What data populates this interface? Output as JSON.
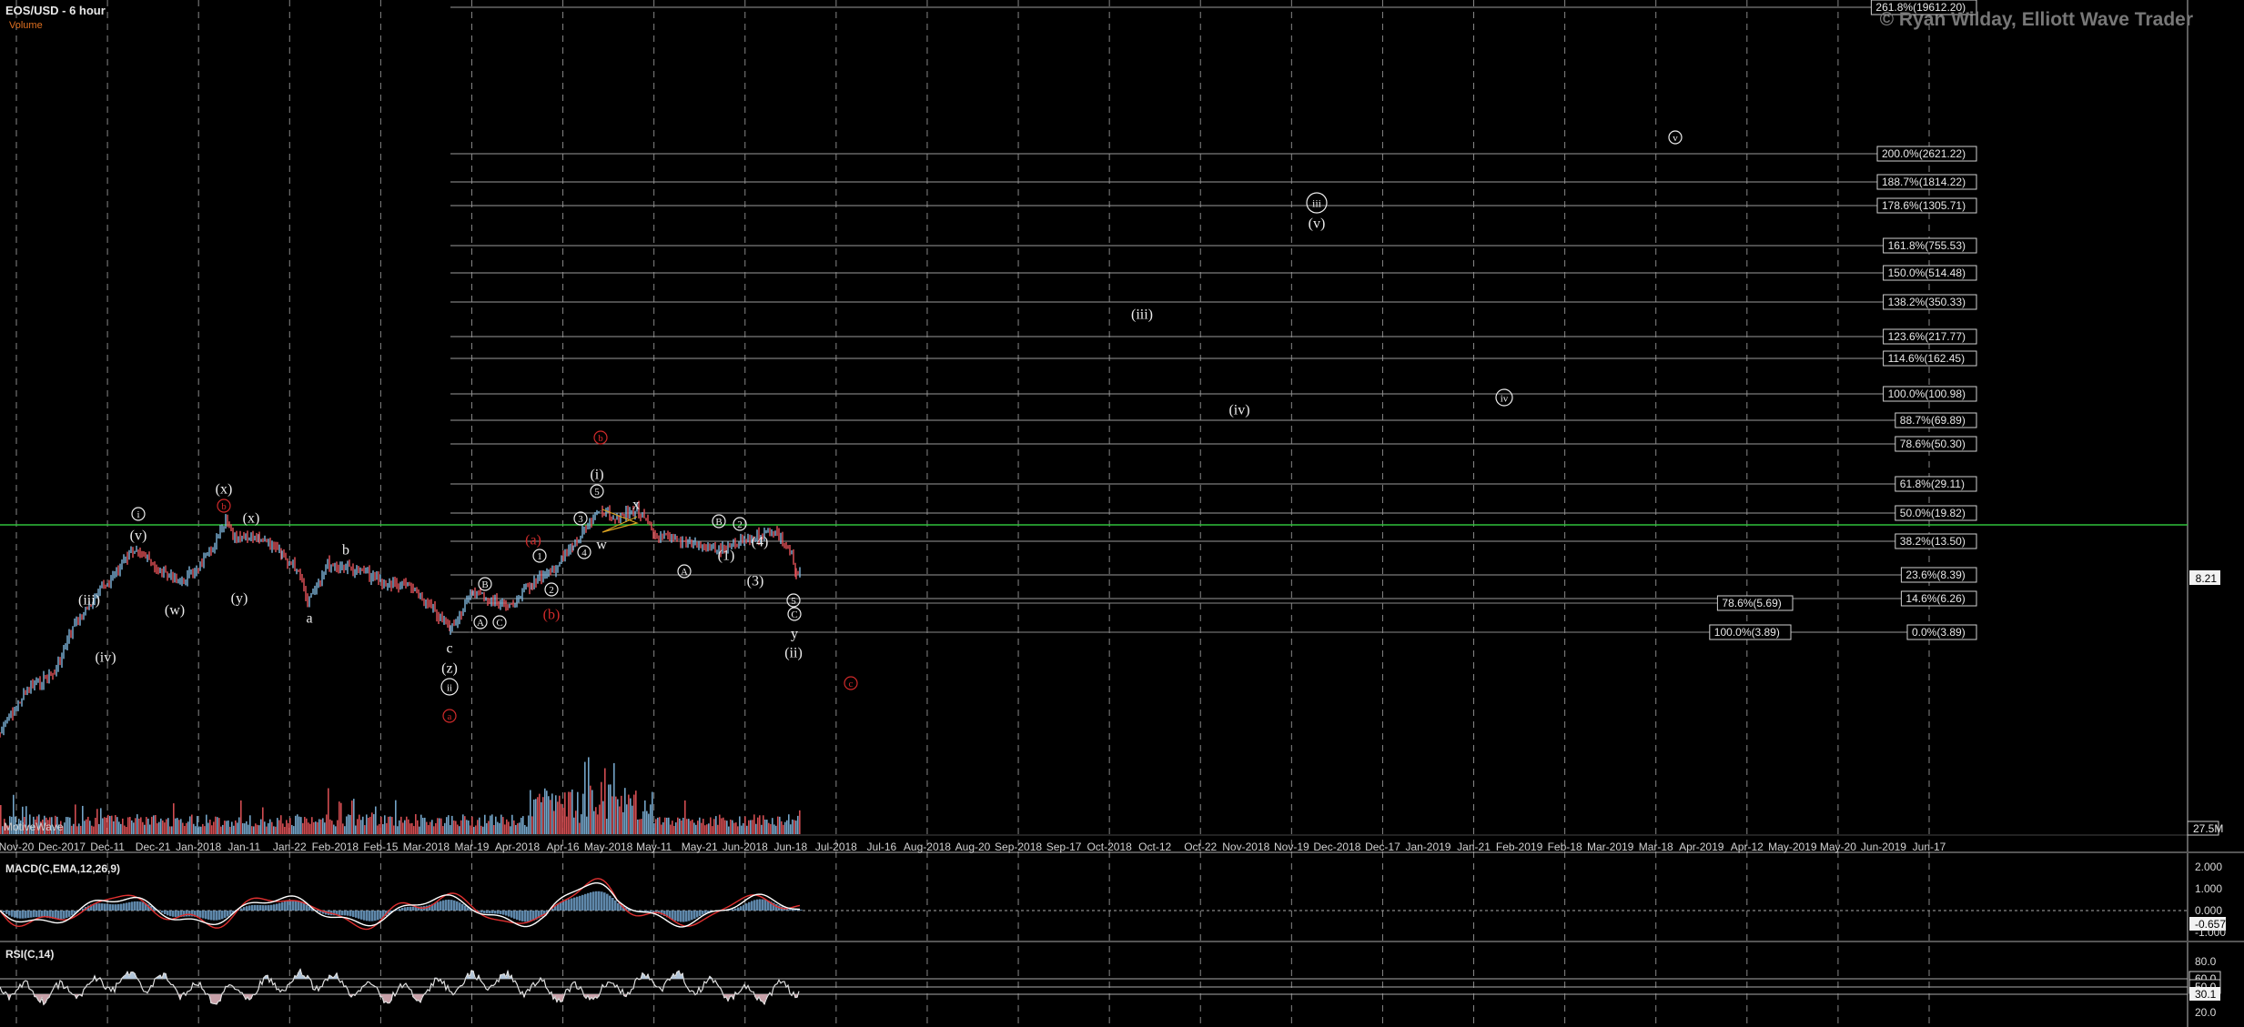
{
  "header": {
    "title": "EOS/USD - 6 hour",
    "volume_label": "Volume",
    "copyright": "© Ryan Wilday, Elliott Wave Trader",
    "watermark": "MotiveWave"
  },
  "indicators": {
    "macd_title": "MACD(C,EMA,12,26,9)",
    "rsi_title": "RSI(C,14)"
  },
  "price_axis": {
    "current_price": "8.21",
    "volume_tag": "27.5M"
  },
  "macd_axis": [
    "2.000",
    "1.000",
    "0.000",
    "-0.657",
    "-1.000"
  ],
  "rsi_axis": [
    "80.0",
    "60.0",
    "50.0",
    "30.1",
    "20.0"
  ],
  "colors": {
    "background": "#000000",
    "up_candle": "#7fb6dd",
    "down_candle": "#e8545a",
    "green_line": "#2fbf3a",
    "macd_line": "#ffffff",
    "signal_line": "#e03030",
    "histogram": "#6f9fc8",
    "red_label": "#d02a2a"
  },
  "chart_data": {
    "type": "line",
    "title": "EOS/USD - 6 hour",
    "x_labels": [
      "Nov-20",
      "Dec-2017",
      "Dec-11",
      "Dec-21",
      "Jan-2018",
      "Jan-11",
      "Jan-22",
      "Feb-2018",
      "Feb-15",
      "Mar-2018",
      "Mar-19",
      "Apr-2018",
      "Apr-16",
      "May-2018",
      "May-11",
      "May-21",
      "Jun-2018",
      "Jun-18",
      "Jul-2018",
      "Jul-16",
      "Aug-2018",
      "Aug-20",
      "Sep-2018",
      "Sep-17",
      "Oct-2018",
      "Oct-12",
      "Oct-22",
      "Nov-2018",
      "Nov-19",
      "Dec-2018",
      "Dec-17",
      "Jan-2019",
      "Jan-21",
      "Feb-2019",
      "Feb-18",
      "Mar-2019",
      "Mar-18",
      "Apr-2019",
      "Apr-12",
      "May-2019",
      "May-20",
      "Jun-2019",
      "Jun-17"
    ],
    "fib_levels": [
      {
        "label": "261.8%(19612.20)"
      },
      {
        "label": "200.0%(2621.22)"
      },
      {
        "label": "188.7%(1814.22)"
      },
      {
        "label": "178.6%(1305.71)"
      },
      {
        "label": "161.8%(755.53)"
      },
      {
        "label": "150.0%(514.48)"
      },
      {
        "label": "138.2%(350.33)"
      },
      {
        "label": "123.6%(217.77)"
      },
      {
        "label": "114.6%(162.45)"
      },
      {
        "label": "100.0%(100.98)"
      },
      {
        "label": "88.7%(69.89)"
      },
      {
        "label": "78.6%(50.30)"
      },
      {
        "label": "61.8%(29.11)"
      },
      {
        "label": "50.0%(19.82)"
      },
      {
        "label": "38.2%(13.50)"
      },
      {
        "label": "23.6%(8.39)"
      },
      {
        "label": "14.6%(6.26)"
      },
      {
        "label": "0.0%(3.89)"
      }
    ],
    "retracement_levels": [
      {
        "label": "78.6%(5.69)"
      },
      {
        "label": "100.0%(3.89)"
      }
    ],
    "wave_labels": [
      {
        "text": "i",
        "circled": true,
        "color": "white"
      },
      {
        "text": "(v)",
        "circled": false,
        "color": "white"
      },
      {
        "text": "(x)",
        "circled": false,
        "color": "white"
      },
      {
        "text": "b",
        "circled": true,
        "color": "red"
      },
      {
        "text": "(x)",
        "circled": false,
        "color": "white"
      },
      {
        "text": "b",
        "circled": false,
        "color": "white"
      },
      {
        "text": "(iii)",
        "circled": false,
        "color": "white"
      },
      {
        "text": "(w)",
        "circled": false,
        "color": "white"
      },
      {
        "text": "(y)",
        "circled": false,
        "color": "white"
      },
      {
        "text": "a",
        "circled": false,
        "color": "white"
      },
      {
        "text": "(iv)",
        "circled": false,
        "color": "white"
      },
      {
        "text": "c",
        "circled": false,
        "color": "white"
      },
      {
        "text": "(z)",
        "circled": false,
        "color": "white"
      },
      {
        "text": "ii",
        "circled": true,
        "color": "white"
      },
      {
        "text": "a",
        "circled": true,
        "color": "red"
      },
      {
        "text": "B",
        "circled": true,
        "color": "white"
      },
      {
        "text": "A",
        "circled": true,
        "color": "white"
      },
      {
        "text": "C",
        "circled": true,
        "color": "white"
      },
      {
        "text": "1",
        "circled": true,
        "color": "white"
      },
      {
        "text": "2",
        "circled": true,
        "color": "white"
      },
      {
        "text": "3",
        "circled": true,
        "color": "white"
      },
      {
        "text": "4",
        "circled": true,
        "color": "white"
      },
      {
        "text": "5",
        "circled": true,
        "color": "white"
      },
      {
        "text": "(i)",
        "circled": false,
        "color": "white"
      },
      {
        "text": "(a)",
        "circled": false,
        "color": "red"
      },
      {
        "text": "(b)",
        "circled": false,
        "color": "red"
      },
      {
        "text": "b",
        "circled": true,
        "color": "red"
      },
      {
        "text": "x",
        "circled": false,
        "color": "white"
      },
      {
        "text": "w",
        "circled": false,
        "color": "white"
      },
      {
        "text": "B",
        "circled": true,
        "color": "white"
      },
      {
        "text": "2",
        "circled": true,
        "color": "white"
      },
      {
        "text": "A",
        "circled": true,
        "color": "white"
      },
      {
        "text": "(1)",
        "circled": false,
        "color": "white"
      },
      {
        "text": "(4)",
        "circled": false,
        "color": "white"
      },
      {
        "text": "(3)",
        "circled": false,
        "color": "white"
      },
      {
        "text": "5",
        "circled": true,
        "color": "white"
      },
      {
        "text": "C",
        "circled": true,
        "color": "white"
      },
      {
        "text": "y",
        "circled": false,
        "color": "white"
      },
      {
        "text": "(ii)",
        "circled": false,
        "color": "white"
      },
      {
        "text": "c",
        "circled": true,
        "color": "red"
      },
      {
        "text": "(iii)",
        "circled": false,
        "color": "white"
      },
      {
        "text": "(iv)",
        "circled": false,
        "color": "white"
      },
      {
        "text": "iii",
        "circled": true,
        "color": "white"
      },
      {
        "text": "(v)",
        "circled": false,
        "color": "white"
      },
      {
        "text": "iv",
        "circled": true,
        "color": "white"
      },
      {
        "text": "v",
        "circled": true,
        "color": "white"
      }
    ]
  }
}
